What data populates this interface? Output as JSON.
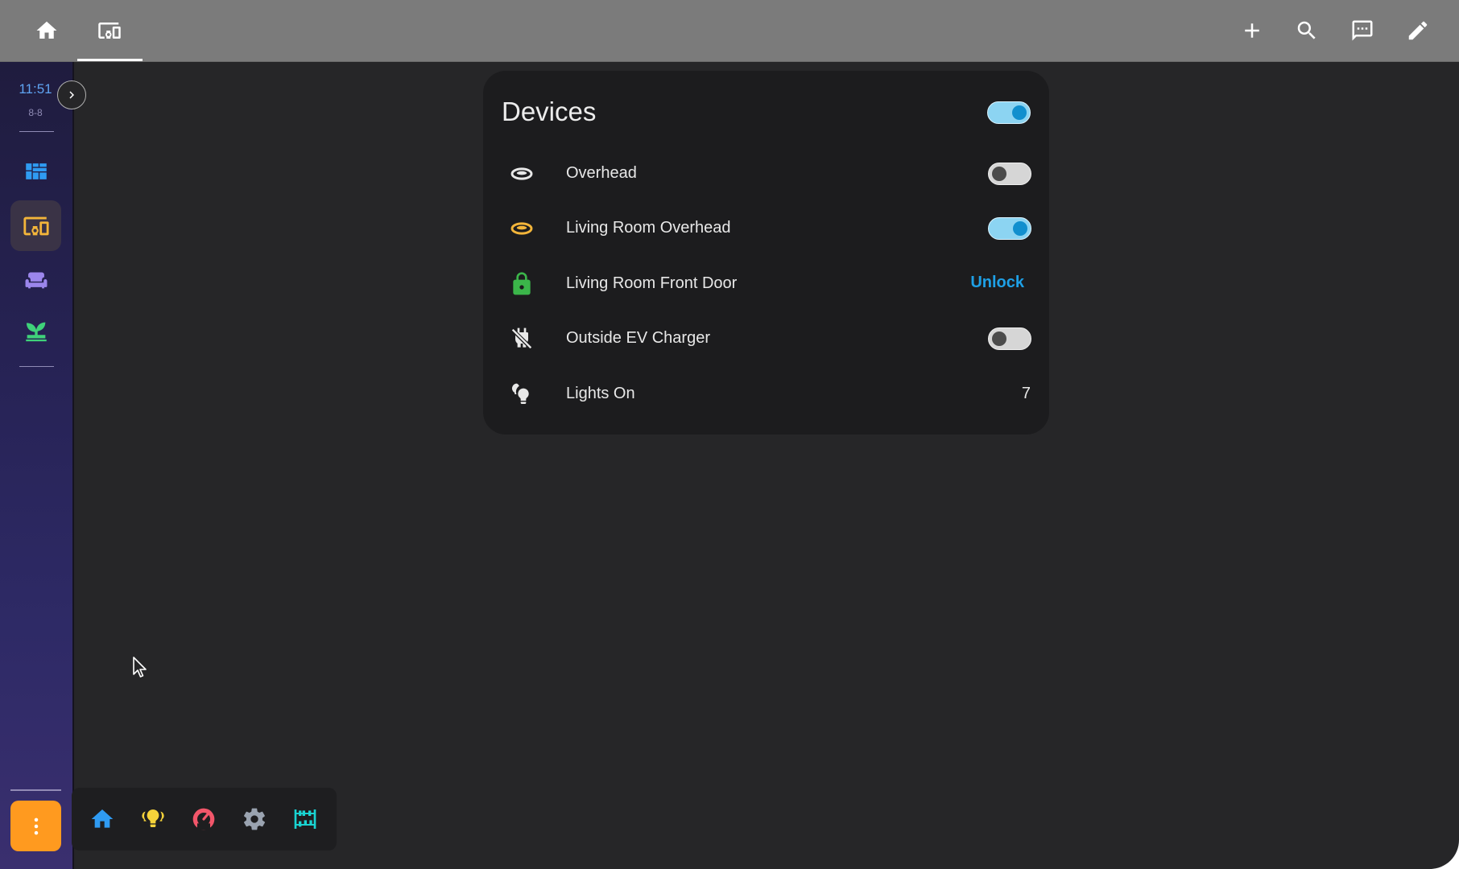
{
  "header": {
    "tabs": [
      {
        "icon": "home-icon"
      },
      {
        "icon": "devices-icon",
        "active": true
      }
    ],
    "actions": [
      {
        "icon": "plus-icon"
      },
      {
        "icon": "search-icon"
      },
      {
        "icon": "chat-icon"
      },
      {
        "icon": "pencil-icon"
      }
    ],
    "bar_color": "#7b7b7b"
  },
  "sidebar": {
    "time": "11:51",
    "date": "8-8",
    "items": [
      {
        "icon": "dashboard-icon",
        "color": "#2f9bf2"
      },
      {
        "icon": "devices-icon",
        "color": "#f3b53a",
        "active": true
      },
      {
        "icon": "sofa-icon",
        "color": "#9b86ec"
      },
      {
        "icon": "sprout-icon",
        "color": "#3fd27a"
      }
    ],
    "menu_color": "#ff9a1f"
  },
  "dock": {
    "items": [
      {
        "icon": "home-icon",
        "color": "#2f9bf2"
      },
      {
        "icon": "lightbulb-group-icon",
        "color": "#f5d23a"
      },
      {
        "icon": "gauge-icon",
        "color": "#f2566a"
      },
      {
        "icon": "gear-icon",
        "color": "#9aa3b0"
      },
      {
        "icon": "abacus-icon",
        "color": "#19d3d1"
      }
    ]
  },
  "card": {
    "title": "Devices",
    "master_toggle": true,
    "rows": [
      {
        "label": "Overhead",
        "icon": "ceiling-light-icon",
        "icon_color": "#e8e8e8",
        "type": "toggle",
        "on": false
      },
      {
        "label": "Living Room Overhead",
        "icon": "ceiling-light-icon",
        "icon_color": "#f3b53a",
        "type": "toggle",
        "on": true
      },
      {
        "label": "Living Room Front Door",
        "icon": "lock-icon",
        "icon_color": "#3bb54a",
        "type": "action",
        "action": "Unlock"
      },
      {
        "label": "Outside EV Charger",
        "icon": "power-plug-off-icon",
        "icon_color": "#e8e8e8",
        "type": "toggle",
        "on": false
      },
      {
        "label": "Lights On",
        "icon": "lightbulb-group-icon",
        "icon_color": "#e8e8e8",
        "type": "value",
        "value": "7"
      }
    ]
  }
}
